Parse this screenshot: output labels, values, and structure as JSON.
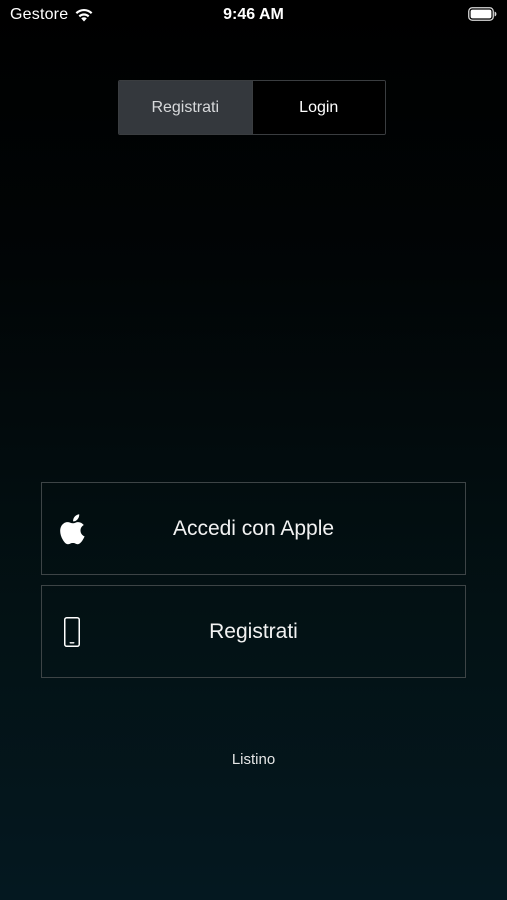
{
  "status_bar": {
    "carrier": "Gestore",
    "time": "9:46 AM",
    "wifi_icon": "wifi-icon",
    "battery_icon": "battery-full-icon"
  },
  "segmented_control": {
    "selected": "register",
    "segments": [
      {
        "label": "Registrati"
      },
      {
        "label": "Login"
      }
    ]
  },
  "actions": {
    "apple": {
      "label": "Accedi con Apple",
      "icon": "apple-logo-icon"
    },
    "register": {
      "label": "Registrati",
      "icon": "smartphone-icon"
    }
  },
  "footer": {
    "price_list_label": "Listino"
  },
  "colors": {
    "background_top": "#000000",
    "background_bottom": "#041820",
    "active_segment": "#34383d",
    "border": "#3d4446",
    "text": "#ffffff"
  }
}
